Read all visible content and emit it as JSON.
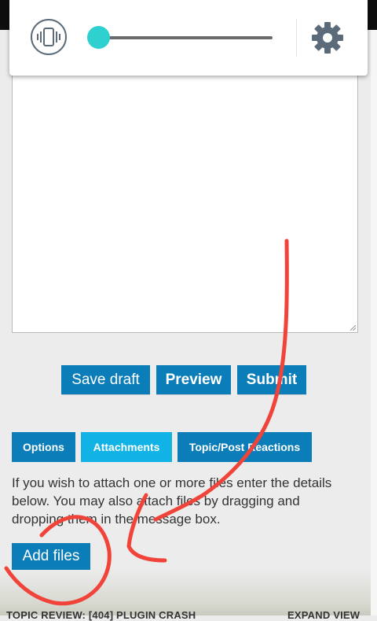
{
  "volume_panel": {
    "vibrate_icon": "vibrate-icon",
    "settings_icon": "gear-icon",
    "volume_level": 0.0,
    "accent_color": "#2fd1d0"
  },
  "editor": {
    "text": ""
  },
  "actions": {
    "save_draft": "Save draft",
    "preview": "Preview",
    "submit": "Submit"
  },
  "tabs": [
    {
      "label": "Options",
      "active": false
    },
    {
      "label": "Attachments",
      "active": true
    },
    {
      "label": "Topic/Post Reactions",
      "active": false
    }
  ],
  "attachments": {
    "help_line1": "If you wish to attach one or more files enter the details",
    "help_line2": "below. You may also attach files by dragging and",
    "help_line3": "dropping them in the message box.",
    "add_files": "Add files"
  },
  "footer": {
    "left": "TOPIC REVIEW: [404] PLUGIN CRASH",
    "right": "EXPAND VIEW"
  },
  "colors": {
    "button": "#0b7db8",
    "tab_active": "#11b3e6",
    "annotation": "#f0443a"
  }
}
